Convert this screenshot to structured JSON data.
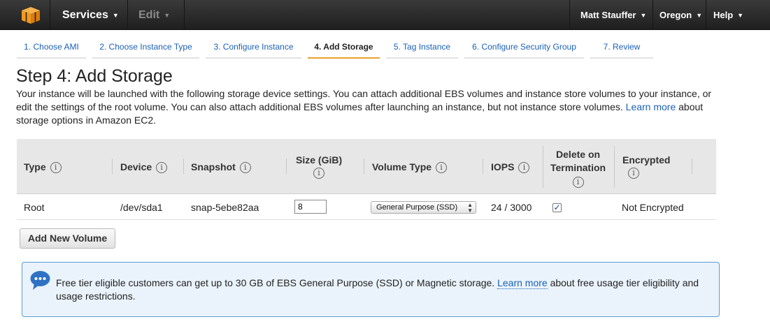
{
  "nav": {
    "services": "Services",
    "edit": "Edit",
    "user": "Matt Stauffer",
    "region": "Oregon",
    "help": "Help"
  },
  "wizard": {
    "steps": [
      "1. Choose AMI",
      "2. Choose Instance Type",
      "3. Configure Instance",
      "4. Add Storage",
      "5. Tag Instance",
      "6. Configure Security Group",
      "7. Review"
    ],
    "active_index": 3
  },
  "page": {
    "title": "Step 4: Add Storage",
    "desc_part1": "Your instance will be launched with the following storage device settings. You can attach additional EBS volumes and instance store volumes to your instance, or edit the settings of the root volume. You can also attach additional EBS volumes after launching an instance, but not instance store volumes.",
    "desc_link": "Learn more",
    "desc_part2": "about storage options in Amazon EC2."
  },
  "table": {
    "headers": {
      "type": "Type",
      "device": "Device",
      "snapshot": "Snapshot",
      "size": "Size (GiB)",
      "volume_type": "Volume Type",
      "iops": "IOPS",
      "delete_line1": "Delete on",
      "delete_line2": "Termination",
      "encrypted": "Encrypted"
    },
    "info_glyph": "i",
    "row": {
      "type": "Root",
      "device": "/dev/sda1",
      "snapshot": "snap-5ebe82aa",
      "size": "8",
      "volume_type": "General Purpose (SSD)",
      "iops": "24 / 3000",
      "delete_on_termination": true,
      "encrypted": "Not Encrypted"
    }
  },
  "add_volume_button": "Add New Volume",
  "infobox": {
    "text1": "Free tier eligible customers can get up to 30 GB of EBS General Purpose (SSD) or Magnetic storage.",
    "link": "Learn more",
    "text2": "about free usage tier eligibility and usage restrictions."
  },
  "colors": {
    "link": "#1b61b6",
    "active_tab": "#e8a02b",
    "aws_orange": "#f29a1f",
    "info_border": "#5b9bd6"
  },
  "icons": {
    "logo": "aws-cube-icon",
    "caret": "chevron-down-icon",
    "info": "info-icon",
    "bubble": "speech-bubble-icon",
    "check": "checkmark-icon"
  }
}
